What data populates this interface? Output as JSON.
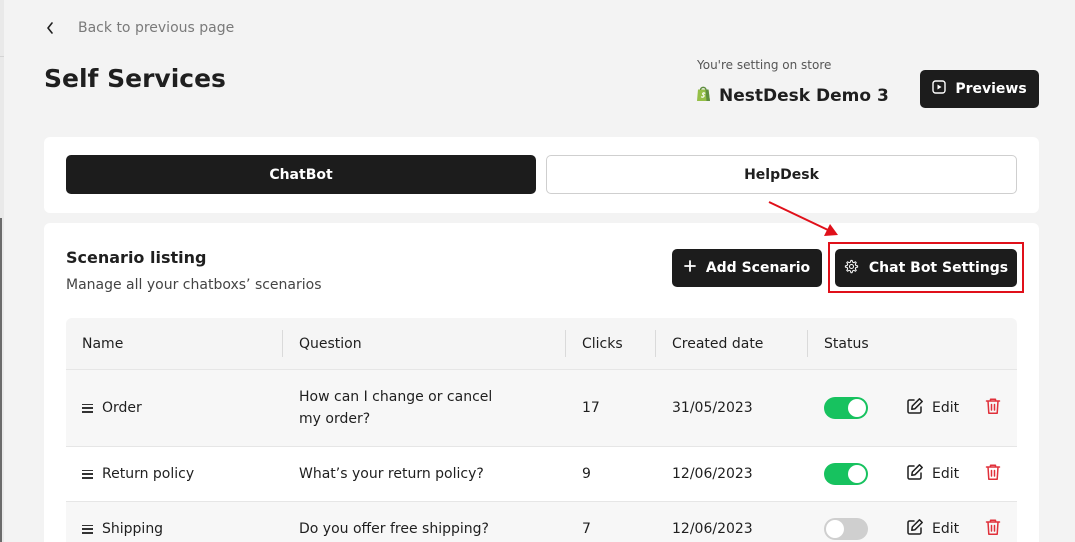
{
  "nav": {
    "back_label": "Back to previous page"
  },
  "page": {
    "title": "Self Services"
  },
  "store": {
    "note": "You're setting on store",
    "name": "NestDesk Demo 3",
    "brand_color": "#95bf47"
  },
  "header": {
    "previews_label": "Previews"
  },
  "tabs": [
    {
      "label": "ChatBot",
      "active": true
    },
    {
      "label": "HelpDesk",
      "active": false
    }
  ],
  "scenarios": {
    "title": "Scenario listing",
    "subtitle": "Manage all your chatboxs’ scenarios",
    "add_label": "Add Scenario",
    "settings_label": "Chat Bot Settings",
    "columns": [
      "Name",
      "Question",
      "Clicks",
      "Created date",
      "Status"
    ],
    "rows": [
      {
        "name": "Order",
        "question": "How can I change or cancel my order?",
        "clicks": "17",
        "date": "31/05/2023",
        "status_on": true,
        "edit_label": "Edit"
      },
      {
        "name": "Return policy",
        "question": "What’s your return policy?",
        "clicks": "9",
        "date": "12/06/2023",
        "status_on": true,
        "edit_label": "Edit"
      },
      {
        "name": "Shipping",
        "question": "Do you offer free shipping?",
        "clicks": "7",
        "date": "12/06/2023",
        "status_on": false,
        "edit_label": "Edit"
      }
    ]
  },
  "colors": {
    "accent_dark": "#1c1c1c",
    "toggle_on": "#17c25f",
    "delete": "#e0303a",
    "highlight": "#e0101a"
  }
}
